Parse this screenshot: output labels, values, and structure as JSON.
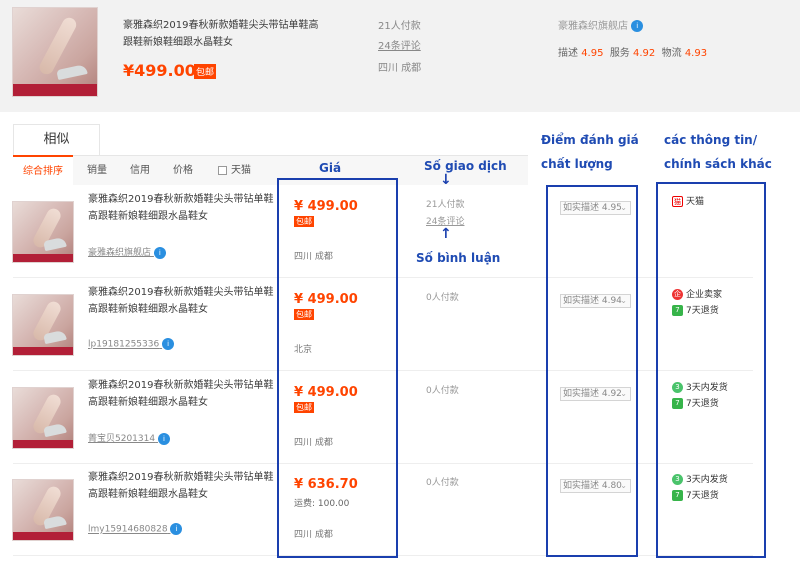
{
  "top_product": {
    "title": "豪雅森织2019春秋新款婚鞋尖头带钻单鞋高跟鞋新娘鞋细跟水晶鞋女",
    "price": "¥499.00",
    "free_ship": "包邮",
    "sold": "21人付款",
    "reviews": "24条评论",
    "location": "四川 成都",
    "shop": "豪雅森织旗舰店",
    "scores": {
      "desc_label": "描述",
      "desc": "4.95",
      "service_label": "服务",
      "service": "4.92",
      "logistics_label": "物流",
      "logistics": "4.93"
    }
  },
  "tabs": {
    "similar": "相似"
  },
  "sort": {
    "items": [
      "综合排序",
      "销量",
      "信用",
      "价格"
    ],
    "tmall_filter": "天猫"
  },
  "rows": [
    {
      "title": "豪雅森织2019春秋新款婚鞋尖头带钻单鞋高跟鞋新娘鞋细跟水晶鞋女",
      "shop": "豪雅森织旗舰店",
      "price": "¥ 499.00",
      "tag": "包邮",
      "shipping": "",
      "location": "四川 成都",
      "sold": "21人付款",
      "reviews": "24条评论",
      "desc": "如实描述 4.95",
      "services": [
        {
          "icon": "tmall-icon",
          "text": "天猫"
        }
      ]
    },
    {
      "title": "豪雅森织2019春秋新款婚鞋尖头带钻单鞋高跟鞋新娘鞋细跟水晶鞋女",
      "shop": "lp19181255336",
      "price": "¥ 499.00",
      "tag": "包邮",
      "shipping": "",
      "location": "北京",
      "sold": "0人付款",
      "reviews": "",
      "desc": "如实描述 4.94",
      "services": [
        {
          "icon": "enterprise-seller-icon",
          "text": "企业卖家"
        },
        {
          "icon": "seven-day-return-icon",
          "text": "7天退货"
        }
      ]
    },
    {
      "title": "豪雅森织2019春秋新款婚鞋尖头带钻单鞋高跟鞋新娘鞋细跟水晶鞋女",
      "shop": "菁宝贝5201314",
      "price": "¥ 499.00",
      "tag": "包邮",
      "shipping": "",
      "location": "四川 成都",
      "sold": "0人付款",
      "reviews": "",
      "desc": "如实描述 4.92",
      "services": [
        {
          "icon": "three-day-ship-icon",
          "text": "3天内发货"
        },
        {
          "icon": "seven-day-return-icon",
          "text": "7天退货"
        }
      ]
    },
    {
      "title": "豪雅森织2019春秋新款婚鞋尖头带钻单鞋高跟鞋新娘鞋细跟水晶鞋女",
      "shop": "lmy15914680828",
      "price": "¥ 636.70",
      "tag": "",
      "shipping": "运费: 100.00",
      "location": "四川 成都",
      "sold": "0人付款",
      "reviews": "",
      "desc": "如实描述 4.80",
      "services": [
        {
          "icon": "three-day-ship-icon",
          "text": "3天内发货"
        },
        {
          "icon": "seven-day-return-icon",
          "text": "7天退货"
        }
      ]
    }
  ],
  "annotations": {
    "price": "Giá",
    "transactions": "Số giao dịch",
    "reviews": "Số bình luận",
    "rating_line1": "Điểm đánh giá",
    "rating_line2": "chất lượng",
    "other_line1": "các thông tin/",
    "other_line2": "chính sách khác"
  },
  "colors": {
    "accent": "#ff4400",
    "annotation": "#1a3fae"
  }
}
